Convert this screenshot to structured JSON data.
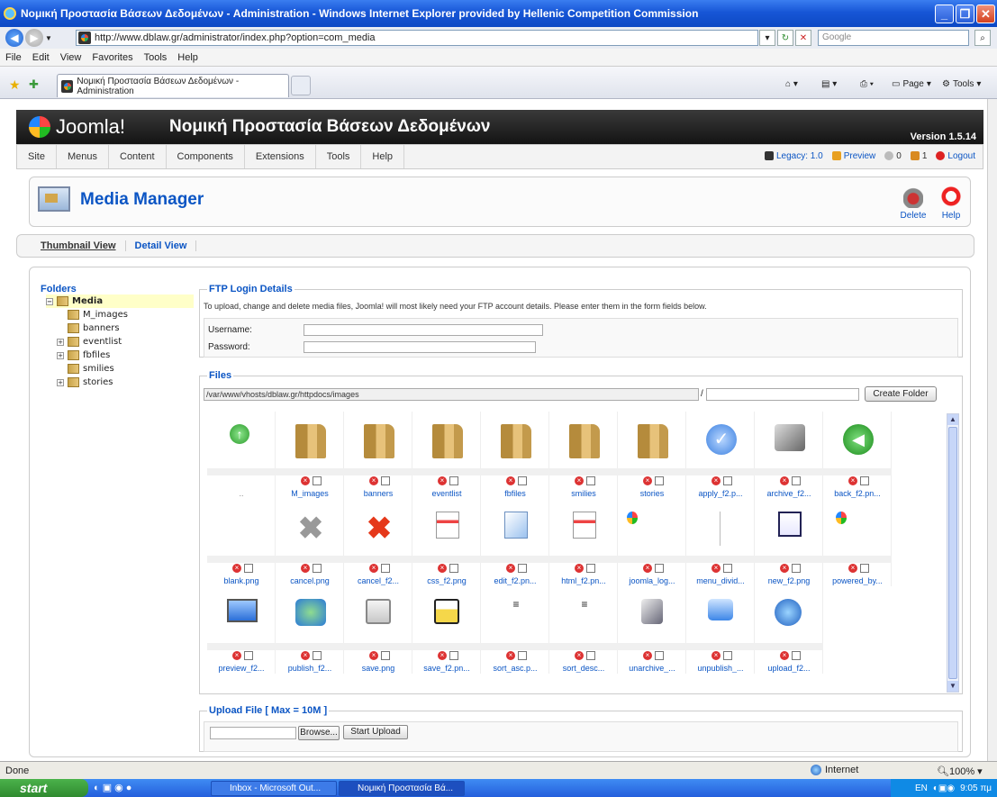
{
  "window": {
    "title": "Νομική Προστασία Βάσεων Δεδομένων - Administration - Windows Internet Explorer provided by Hellenic Competition Commission"
  },
  "browser": {
    "url": "http://www.dblaw.gr/administrator/index.php?option=com_media",
    "search_placeholder": "Google",
    "menu": [
      "File",
      "Edit",
      "View",
      "Favorites",
      "Tools",
      "Help"
    ],
    "tab_title": "Νομική Προστασία Βάσεων Δεδομένων - Administration",
    "toolbar_page": "Page",
    "toolbar_tools": "Tools",
    "status": "Done",
    "zone": "Internet",
    "zoom": "100%"
  },
  "joomla": {
    "logo": "Joomla!",
    "site_name": "Νομική Προστασία Βάσεων Δεδομένων",
    "version": "Version 1.5.14",
    "menu": [
      "Site",
      "Menus",
      "Content",
      "Components",
      "Extensions",
      "Tools",
      "Help"
    ],
    "legacy": "Legacy: 1.0",
    "preview": "Preview",
    "msgs": "0",
    "users": "1",
    "logout": "Logout",
    "page_title": "Media Manager",
    "delete_label": "Delete",
    "help_label": "Help",
    "thumb_view": "Thumbnail View",
    "detail_view": "Detail View",
    "folders_title": "Folders",
    "folders": [
      "Media",
      "M_images",
      "banners",
      "eventlist",
      "fbfiles",
      "smilies",
      "stories"
    ],
    "ftp": {
      "legend": "FTP Login Details",
      "note": "To upload, change and delete media files, Joomla! will most likely need your FTP account details. Please enter them in the form fields below.",
      "username": "Username:",
      "password": "Password:"
    },
    "files": {
      "legend": "Files",
      "path": "/var/www/vhosts/dblaw.gr/httpdocs/images",
      "slash": "/",
      "create_folder": "Create Folder",
      "up": "..",
      "items": [
        "M_images",
        "banners",
        "eventlist",
        "fbfiles",
        "smilies",
        "stories",
        "apply_f2.p...",
        "archive_f2...",
        "back_f2.pn...",
        "blank.png",
        "cancel.png",
        "cancel_f2...",
        "css_f2.png",
        "edit_f2.pn...",
        "html_f2.pn...",
        "joomla_log...",
        "menu_divid...",
        "new_f2.png",
        "powered_by...",
        "preview_f2...",
        "publish_f2...",
        "save.png",
        "save_f2.pn...",
        "sort_asc.p...",
        "sort_desc...",
        "unarchive_...",
        "unpublish_...",
        "upload_f2..."
      ]
    },
    "upload": {
      "legend": "Upload File [ Max = 10M ]",
      "browse": "Browse...",
      "start": "Start Upload"
    }
  },
  "taskbar": {
    "start": "start",
    "tasks": [
      "Inbox - Microsoft Out...",
      "Νομική Προστασία Βά..."
    ],
    "lang": "EN",
    "time": "9:05 πμ"
  }
}
